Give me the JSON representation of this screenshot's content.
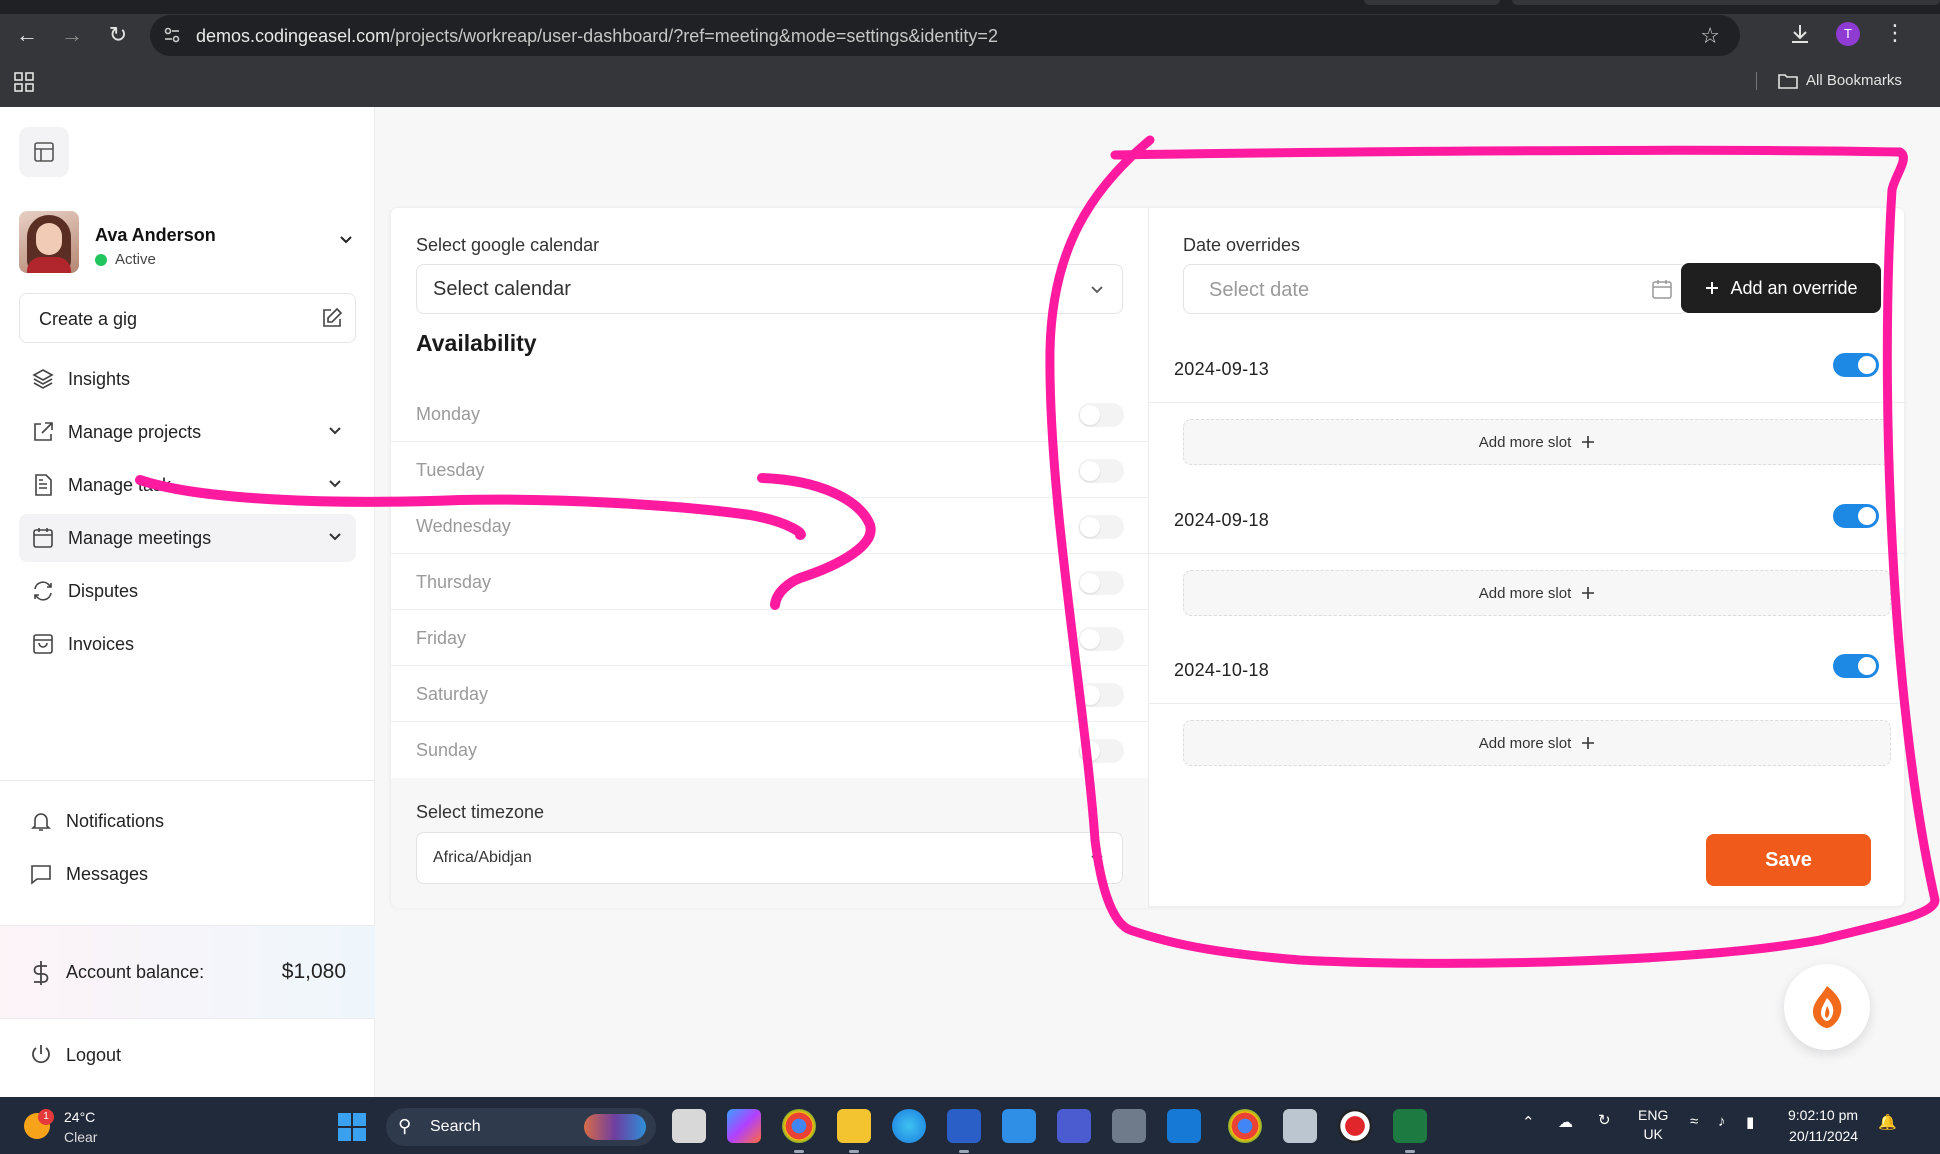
{
  "browser": {
    "url_host": "demos.codingeasel.com",
    "url_path": "/projects/workreap/user-dashboard/?ref=meeting&mode=settings&identity=2",
    "profile_initial": "T",
    "bookmarks_label": "All Bookmarks"
  },
  "sidebar": {
    "user": {
      "name": "Ava Anderson",
      "status": "Active"
    },
    "create_gig": "Create a gig",
    "items": [
      {
        "label": "Insights",
        "icon": "layers-icon"
      },
      {
        "label": "Manage projects",
        "icon": "external-link-icon",
        "has_chevron": true
      },
      {
        "label": "Manage task",
        "icon": "document-icon",
        "has_chevron": true
      },
      {
        "label": "Manage meetings",
        "icon": "calendar-icon",
        "has_chevron": true,
        "active": true
      },
      {
        "label": "Disputes",
        "icon": "refresh-icon"
      },
      {
        "label": "Invoices",
        "icon": "bag-icon"
      }
    ],
    "secondary": [
      {
        "label": "Notifications",
        "icon": "bell-icon"
      },
      {
        "label": "Messages",
        "icon": "message-icon"
      }
    ],
    "balance_label": "Account balance:",
    "balance_value": "$1,080",
    "logout": "Logout"
  },
  "availability": {
    "calendar_label": "Select google calendar",
    "calendar_value": "Select calendar",
    "title": "Availability",
    "days": [
      "Monday",
      "Tuesday",
      "Wednesday",
      "Thursday",
      "Friday",
      "Saturday",
      "Sunday"
    ],
    "timezone_label": "Select timezone",
    "timezone_value": "Africa/Abidjan"
  },
  "overrides": {
    "label": "Date overrides",
    "date_placeholder": "Select date",
    "add_button": "Add an override",
    "entries": [
      {
        "date": "2024-09-13",
        "enabled": true
      },
      {
        "date": "2024-09-18",
        "enabled": true
      },
      {
        "date": "2024-10-18",
        "enabled": true
      }
    ],
    "add_slot_label": "Add more slot",
    "save_button": "Save"
  },
  "taskbar": {
    "weather_temp": "24°C",
    "weather_cond": "Clear",
    "weather_badge": "1",
    "search_label": "Search",
    "lang_1": "ENG",
    "lang_2": "UK",
    "time": "9:02:10 pm",
    "date": "20/11/2024"
  },
  "colors": {
    "accent_save": "#f05a1a",
    "toggle_on": "#1e88e5",
    "annotation": "#ff1493"
  }
}
